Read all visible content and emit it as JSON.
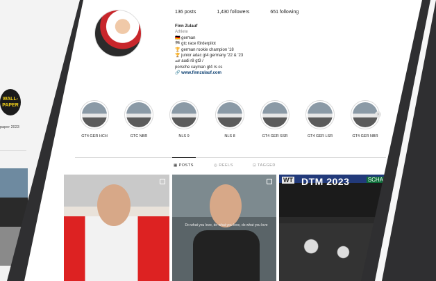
{
  "profile": {
    "posts": "136 posts",
    "followers": "1,430 followers",
    "following": "651 following",
    "name": "Finn Zulauf",
    "category": "Athlete",
    "bio_lines": [
      "🇩🇪 german",
      "🏁 gtc race förderpilot",
      "🏆 german rookie champion '18",
      "🏆 junior adac gt4 germany '22 & '23",
      "🏎 audi r8 gt3 /",
      "porsche cayman gt4 rs cs"
    ],
    "link": "www.finnzulauf.com",
    "link_icon": "link-icon"
  },
  "highlights": [
    "GT4 GER HCH",
    "GTC NBR",
    "NLS 9",
    "NLS 8",
    "GT4 GER SSR",
    "GT4 GER LSR",
    "GT4 GER NBR"
  ],
  "tabs": {
    "posts": "POSTS",
    "reels": "REELS",
    "tagged": "TAGGED"
  },
  "posts": {
    "post2_caption": "Do what you love, do what you love, do what you love",
    "post3_title": "DTM 2023",
    "post3_left_label": "WT",
    "post3_right_label": "SCHA"
  },
  "left_panel": {
    "badge": "WALL-PAPER",
    "caption": "paper 2023"
  }
}
